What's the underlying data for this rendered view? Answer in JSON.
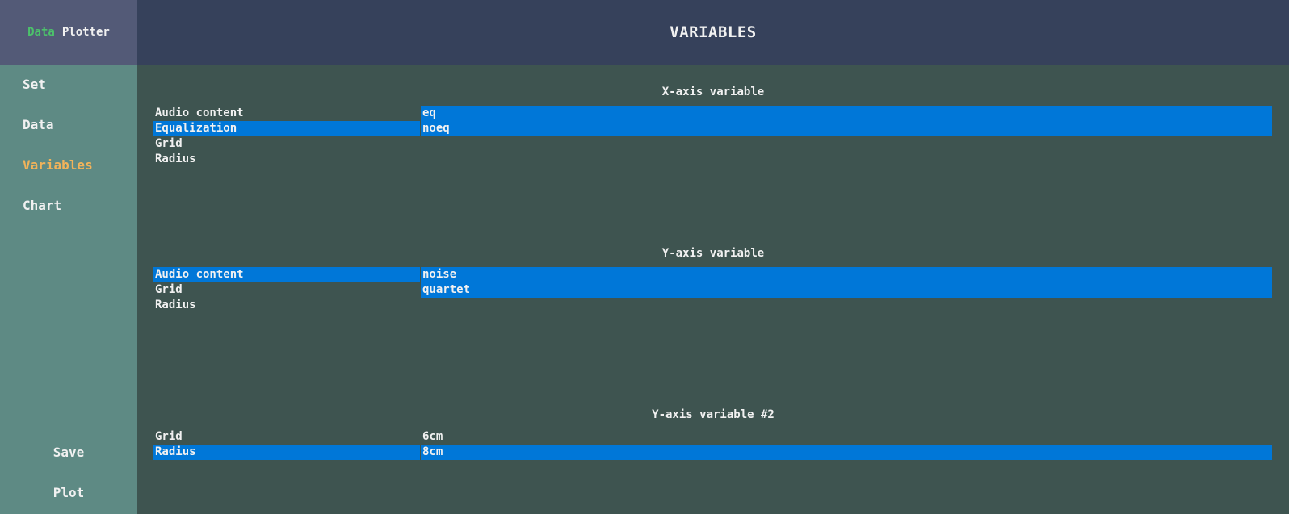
{
  "app": {
    "title_part1": "Data",
    "title_part2": "Plotter"
  },
  "header": {
    "title": "VARIABLES"
  },
  "sidebar": {
    "items": [
      {
        "label": "Set"
      },
      {
        "label": "Data"
      },
      {
        "label": "Variables"
      },
      {
        "label": "Chart"
      }
    ],
    "active_item": "Variables",
    "save_label": "Save",
    "plot_label": "Plot"
  },
  "sections": [
    {
      "title": "X-axis variable",
      "variables": [
        "Audio content",
        "Equalization",
        "Grid",
        "Radius"
      ],
      "selected_variable": "Equalization",
      "values": [
        "eq",
        "noeq"
      ],
      "selected_values": [
        "eq",
        "noeq"
      ]
    },
    {
      "title": "Y-axis variable",
      "variables": [
        "Audio content",
        "Grid",
        "Radius"
      ],
      "selected_variable": "Audio content",
      "values": [
        "noise",
        "quartet"
      ],
      "selected_values": [
        "noise",
        "quartet"
      ]
    },
    {
      "title": "Y-axis variable #2",
      "variables": [
        "Grid",
        "Radius"
      ],
      "selected_variable": "Radius",
      "values": [
        "6cm",
        "8cm"
      ],
      "selected_values": [
        "8cm"
      ]
    }
  ],
  "colors": {
    "selection": "#0077d8",
    "active_nav": "#f2b35a",
    "logo_accent": "#4cc16b"
  }
}
